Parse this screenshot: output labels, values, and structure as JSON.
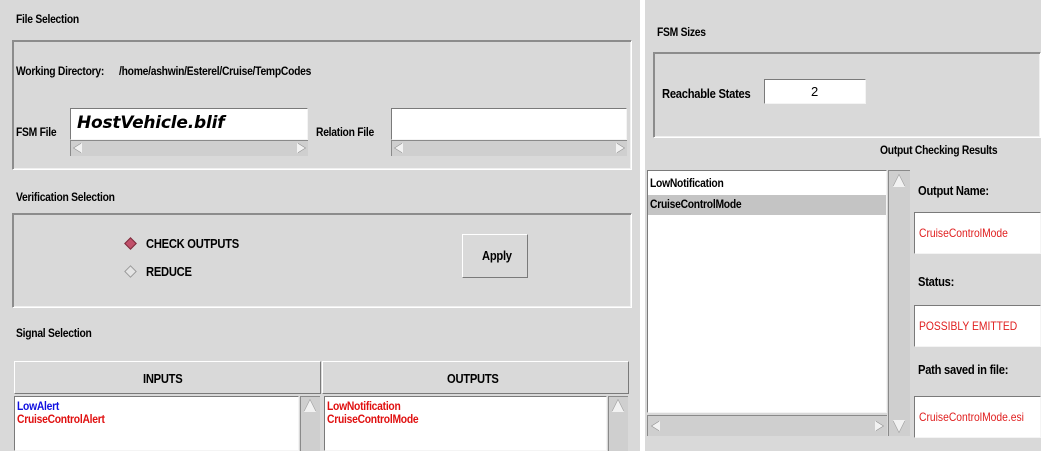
{
  "file_selection": {
    "title": "File Selection",
    "working_dir_label": "Working Directory:",
    "working_dir_value": "/home/ashwin/Esterel/Cruise/TempCodes",
    "fsm_file_label": "FSM File",
    "fsm_file_value": "HostVehicle.blif",
    "relation_file_label": "Relation File",
    "relation_file_value": ""
  },
  "verification": {
    "title": "Verification Selection",
    "options": [
      {
        "label": "CHECK OUTPUTS",
        "selected": true
      },
      {
        "label": "REDUCE",
        "selected": false
      }
    ],
    "apply_label": "Apply"
  },
  "signal_selection": {
    "title": "Signal Selection",
    "inputs_header": "INPUTS",
    "outputs_header": "OUTPUTS",
    "inputs": [
      {
        "name": "LowAlert",
        "color": "#1010e0"
      },
      {
        "name": "CruiseControlAlert",
        "color": "#e01010"
      }
    ],
    "outputs": [
      {
        "name": "LowNotification",
        "color": "#e01010"
      },
      {
        "name": "CruiseControlMode",
        "color": "#e01010"
      }
    ]
  },
  "fsm_sizes": {
    "title": "FSM Sizes",
    "reachable_label": "Reachable States",
    "reachable_value": "2"
  },
  "output_checking": {
    "title": "Output Checking Results",
    "list": [
      {
        "name": "LowNotification",
        "selected": false
      },
      {
        "name": "CruiseControlMode",
        "selected": true
      }
    ],
    "output_name_label": "Output Name:",
    "output_name_value": "CruiseControlMode",
    "status_label": "Status:",
    "status_value": "POSSIBLY EMITTED",
    "path_label": "Path saved in file:",
    "path_value": "CruiseControlMode.esi"
  },
  "colors": {
    "panel_bg": "#d9d9d9",
    "selection_marker": "#c0506a",
    "selected_row": "#c4c4c4",
    "status_red": "#e02020",
    "input_blue": "#1010e0"
  }
}
